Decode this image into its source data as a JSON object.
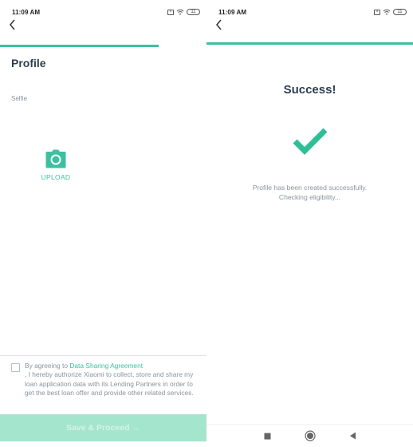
{
  "colors": {
    "accent": "#3cc0a0",
    "accent_disabled_bg": "#a4e5cd",
    "accent_disabled_text": "#d4f3e7",
    "title_text": "#2f3e4e",
    "muted_text": "#8a949e"
  },
  "left_screen": {
    "status_bar": {
      "time": "11:09 AM",
      "icons": [
        "sim-card-icon",
        "wifi-icon",
        "battery-icon"
      ],
      "battery_level": "11"
    },
    "back_icon": "chevron-left-icon",
    "progress_fraction": 0.77,
    "page_title": "Profile",
    "selfie_label": "Selfie",
    "upload": {
      "icon": "camera-icon",
      "label": "UPLOAD"
    },
    "consent": {
      "checked": false,
      "prefix": "By agreeing to ",
      "link_text": "Data Sharing Agreement",
      "body": ", I hereby authorize Xiaomi to collect, store and share my loan application data with its Lending Partners in order to get the best loan offer and provide other related services."
    },
    "save_button": {
      "label": "Save & Proceed →",
      "enabled": false
    }
  },
  "right_screen": {
    "status_bar": {
      "time": "11:09 AM",
      "icons": [
        "sim-card-icon",
        "wifi-icon",
        "battery-icon"
      ],
      "battery_level": "11"
    },
    "back_icon": "chevron-left-icon",
    "progress_fraction": 1.0,
    "title": "Success!",
    "success_icon": "checkmark-icon",
    "message_line1": "Profile has been created successfully.",
    "message_line2": "Checking eligibility...",
    "nav_bar": {
      "recent": "square-icon",
      "home": "circle-icon",
      "back": "triangle-back-icon"
    }
  }
}
